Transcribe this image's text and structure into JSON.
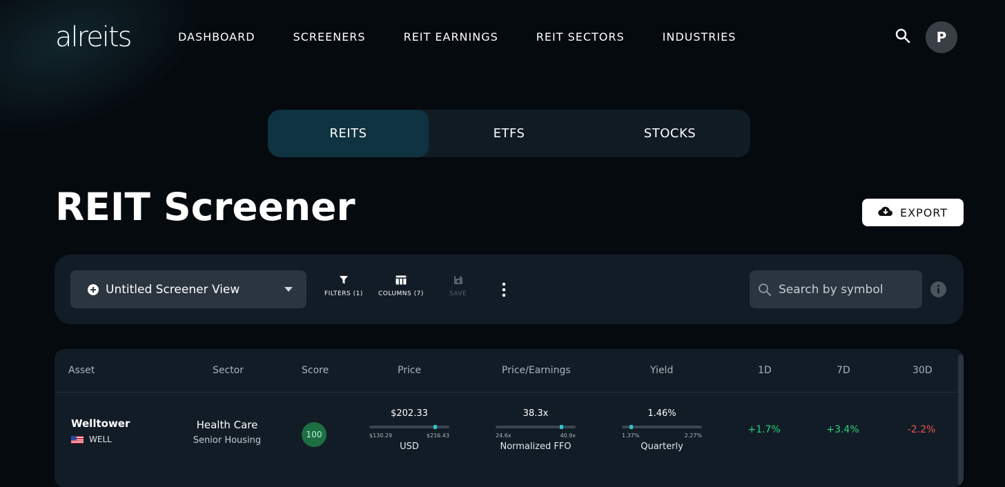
{
  "nav": {
    "logo": "alreits",
    "links": [
      "DASHBOARD",
      "SCREENERS",
      "REIT EARNINGS",
      "REIT SECTORS",
      "INDUSTRIES"
    ],
    "avatar_initial": "P"
  },
  "tabs": [
    {
      "label": "REITS",
      "active": true
    },
    {
      "label": "ETFS",
      "active": false
    },
    {
      "label": "STOCKS",
      "active": false
    }
  ],
  "page": {
    "title": "REIT Screener",
    "export_label": "EXPORT"
  },
  "toolbar": {
    "view_name": "Untitled Screener View",
    "filters_label": "FILTERS (1)",
    "columns_label": "COLUMNS (7)",
    "save_label": "SAVE",
    "search_placeholder": "Search by symbol"
  },
  "table": {
    "headers": [
      "Asset",
      "Sector",
      "Score",
      "Price",
      "Price/Earnings",
      "Yield",
      "1D",
      "7D",
      "30D"
    ],
    "rows": [
      {
        "name": "Welltower",
        "symbol": "WELL",
        "sector": "Health Care",
        "subsector": "Senior Housing",
        "score": "100",
        "price": {
          "value": "$202.33",
          "low": "$130.29",
          "high": "$216.43",
          "unit": "USD",
          "position": 0.84
        },
        "pe": {
          "value": "38.3x",
          "low": "24.6x",
          "high": "40.9x",
          "unit": "Normalized FFO",
          "position": 0.84
        },
        "yield": {
          "value": "1.46%",
          "low": "1.37%",
          "high": "2.27%",
          "unit": "Quarterly",
          "position": 0.1
        },
        "d1": "+1.7%",
        "d7": "+3.4%",
        "d30": "-2.2%"
      }
    ]
  },
  "colors": {
    "accent": "#0f3340",
    "positive": "#2bd37b",
    "negative": "#ef5350",
    "score_bg": "#1e6e44"
  }
}
